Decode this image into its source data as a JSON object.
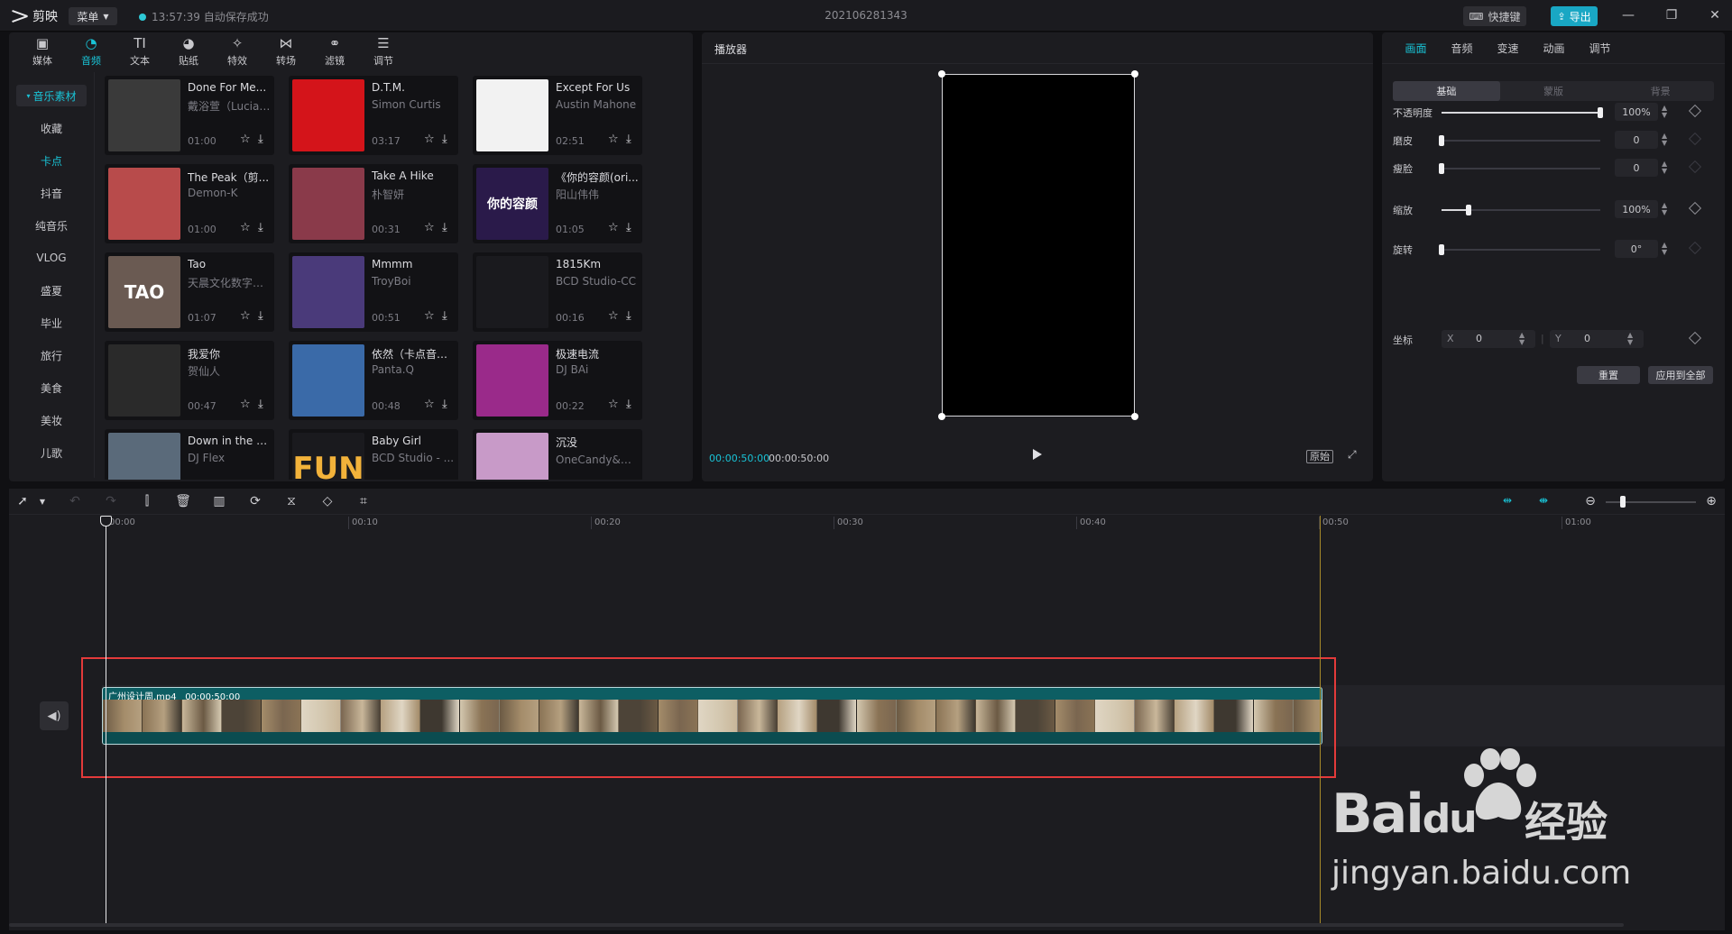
{
  "app": {
    "name": "剪映",
    "menu_label": "菜单",
    "save_status": "13:57:39 自动保存成功",
    "project_title": "202106281343",
    "shortcut_label": "快捷键",
    "export_label": "导出"
  },
  "media_tabs": [
    {
      "label": "媒体",
      "icon": "media-icon"
    },
    {
      "label": "音频",
      "icon": "audio-icon"
    },
    {
      "label": "文本",
      "icon": "text-icon"
    },
    {
      "label": "贴纸",
      "icon": "sticker-icon"
    },
    {
      "label": "特效",
      "icon": "effects-icon"
    },
    {
      "label": "转场",
      "icon": "transition-icon"
    },
    {
      "label": "滤镜",
      "icon": "filter-icon"
    },
    {
      "label": "调节",
      "icon": "adjust-icon"
    }
  ],
  "categories": {
    "header": "音乐素材",
    "items": [
      "收藏",
      "卡点",
      "抖音",
      "纯音乐",
      "VLOG",
      "盛夏",
      "毕业",
      "旅行",
      "美食",
      "美妆",
      "儿歌"
    ]
  },
  "music": [
    {
      "title": "Done For Me...",
      "artist": "戴浴萱（Lucian...",
      "duration": "01:00",
      "color": "#3a3a3a"
    },
    {
      "title": "D.T.M.",
      "artist": "Simon Curtis",
      "duration": "03:17",
      "color": "#d4141a"
    },
    {
      "title": "Except For Us",
      "artist": "Austin Mahone",
      "duration": "02:51",
      "color": "#f2f2f2"
    },
    {
      "title": "The Peak（剪...",
      "artist": "Demon-K",
      "duration": "01:00",
      "color": "#b84b4b"
    },
    {
      "title": "Take A Hike",
      "artist": "朴智妍",
      "duration": "00:31",
      "color": "#8a3a4a"
    },
    {
      "title": "《你的容颜(ori...",
      "artist": "阳山伟伟",
      "duration": "01:05",
      "color": "#2a1a4a"
    },
    {
      "title": "Tao",
      "artist": "天晨文化数字唱片",
      "duration": "01:07",
      "color": "#6a5a52"
    },
    {
      "title": "Mmmm",
      "artist": "TroyBoi",
      "duration": "00:51",
      "color": "#4a3a7a"
    },
    {
      "title": "1815Km",
      "artist": "BCD Studio-CC",
      "duration": "00:16",
      "color": "#1a1a1e"
    },
    {
      "title": "我爱你",
      "artist": "贺仙人",
      "duration": "00:47",
      "color": "#2a2a2a"
    },
    {
      "title": "依然（卡点音乐）",
      "artist": "Panta.Q",
      "duration": "00:48",
      "color": "#3a6aa8"
    },
    {
      "title": "极速电流",
      "artist": "DJ BAi",
      "duration": "00:22",
      "color": "#9a2a8a"
    },
    {
      "title": "Down in the D...",
      "artist": "DJ Flex",
      "duration": "",
      "color": "#5a6a7a"
    },
    {
      "title": "Baby Girl",
      "artist": "BCD Studio - ...",
      "duration": "",
      "color": "#1a1a1e"
    },
    {
      "title": "沉没",
      "artist": "OneCandy&刘...",
      "duration": "",
      "color": "#c89ac8"
    }
  ],
  "thumb_texts": {
    "tao": "TAO",
    "fun": "FUN",
    "rongyan": "你的容颜"
  },
  "player": {
    "title": "播放器",
    "current_time": "00:00:50:00",
    "total_time": "00:00:50:00",
    "ratio_label": "原始"
  },
  "props": {
    "tabs": [
      "画面",
      "音频",
      "变速",
      "动画",
      "调节"
    ],
    "sub_tabs": [
      "基础",
      "蒙版",
      "背景"
    ],
    "rows": [
      {
        "label": "不透明度",
        "value": "100%",
        "level": 1.0
      },
      {
        "label": "磨皮",
        "value": "0",
        "level": 0.0
      },
      {
        "label": "瘦脸",
        "value": "0",
        "level": 0.0
      },
      {
        "label": "缩放",
        "value": "100%",
        "level": 0.17
      },
      {
        "label": "旋转",
        "value": "0°",
        "level": 0.0
      }
    ],
    "position": {
      "label": "坐标",
      "x_label": "X",
      "x_value": "0",
      "y_label": "Y",
      "y_value": "0"
    },
    "reset_label": "重置",
    "apply_all_label": "应用到全部"
  },
  "timeline": {
    "ticks": [
      "00:00",
      "00:10",
      "00:20",
      "00:30",
      "00:40",
      "00:50",
      "01:00"
    ],
    "clip": {
      "name": "广州设计周.mp4",
      "duration": "00:00:50:00"
    }
  },
  "watermark": {
    "brand": "Bai",
    "brand2": "du",
    "cn": "经验",
    "url": "jingyan.baidu.com"
  }
}
